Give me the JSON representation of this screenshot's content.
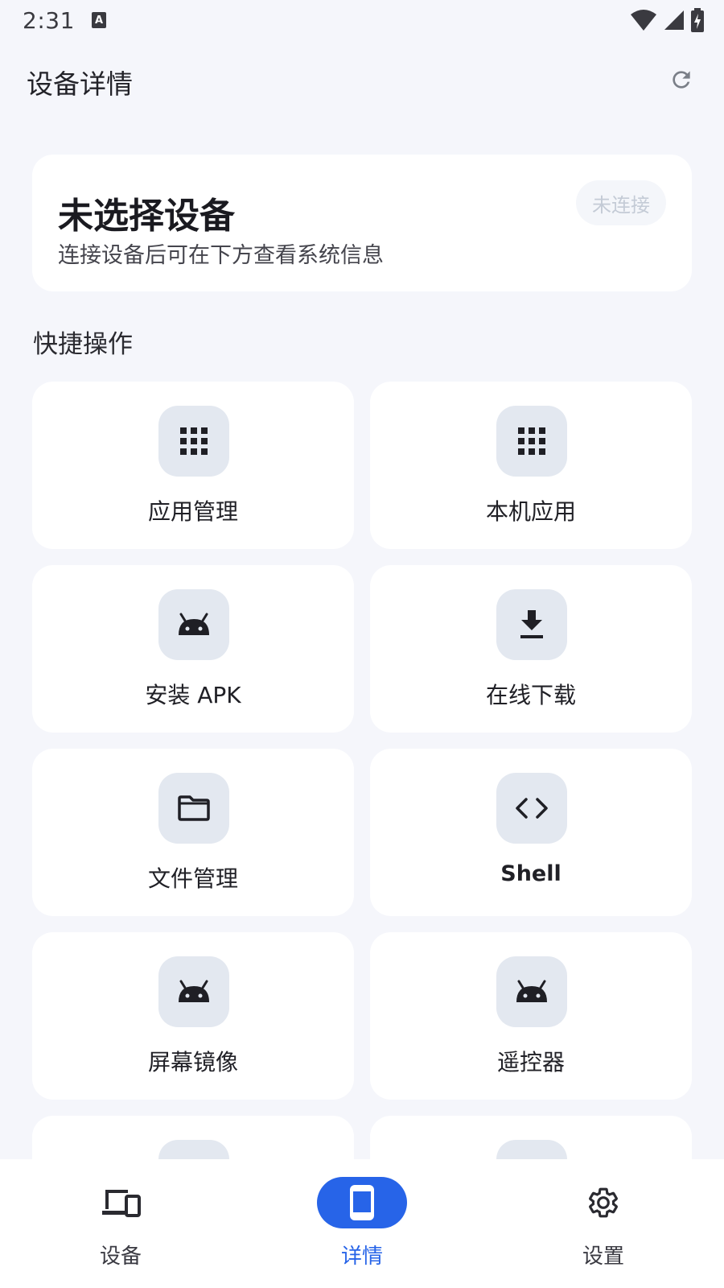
{
  "status_bar": {
    "time": "2:31",
    "icons": [
      "keyboard-a-icon",
      "wifi-icon",
      "signal-icon",
      "battery-charging-icon"
    ]
  },
  "app_bar": {
    "title": "设备详情",
    "refresh_icon": "refresh-icon"
  },
  "device_card": {
    "title": "未选择设备",
    "subtitle": "连接设备后可在下方查看系统信息",
    "status_badge": "未连接"
  },
  "quick_actions": {
    "title": "快捷操作",
    "items": [
      {
        "label": "应用管理",
        "icon": "apps-grid-icon"
      },
      {
        "label": "本机应用",
        "icon": "apps-grid-icon"
      },
      {
        "label": "安装 APK",
        "icon": "android-icon"
      },
      {
        "label": "在线下载",
        "icon": "download-icon"
      },
      {
        "label": "文件管理",
        "icon": "folder-icon"
      },
      {
        "label": "Shell",
        "icon": "code-icon"
      },
      {
        "label": "屏幕镜像",
        "icon": "android-icon"
      },
      {
        "label": "遥控器",
        "icon": "android-icon"
      }
    ]
  },
  "bottom_nav": {
    "items": [
      {
        "label": "设备",
        "icon": "devices-icon",
        "active": false
      },
      {
        "label": "详情",
        "icon": "phone-icon",
        "active": true
      },
      {
        "label": "设置",
        "icon": "gear-icon",
        "active": false
      }
    ]
  },
  "colors": {
    "accent": "#2764e8",
    "background": "#f5f6fb",
    "card": "#ffffff",
    "icon_box": "#e3e8f0"
  }
}
